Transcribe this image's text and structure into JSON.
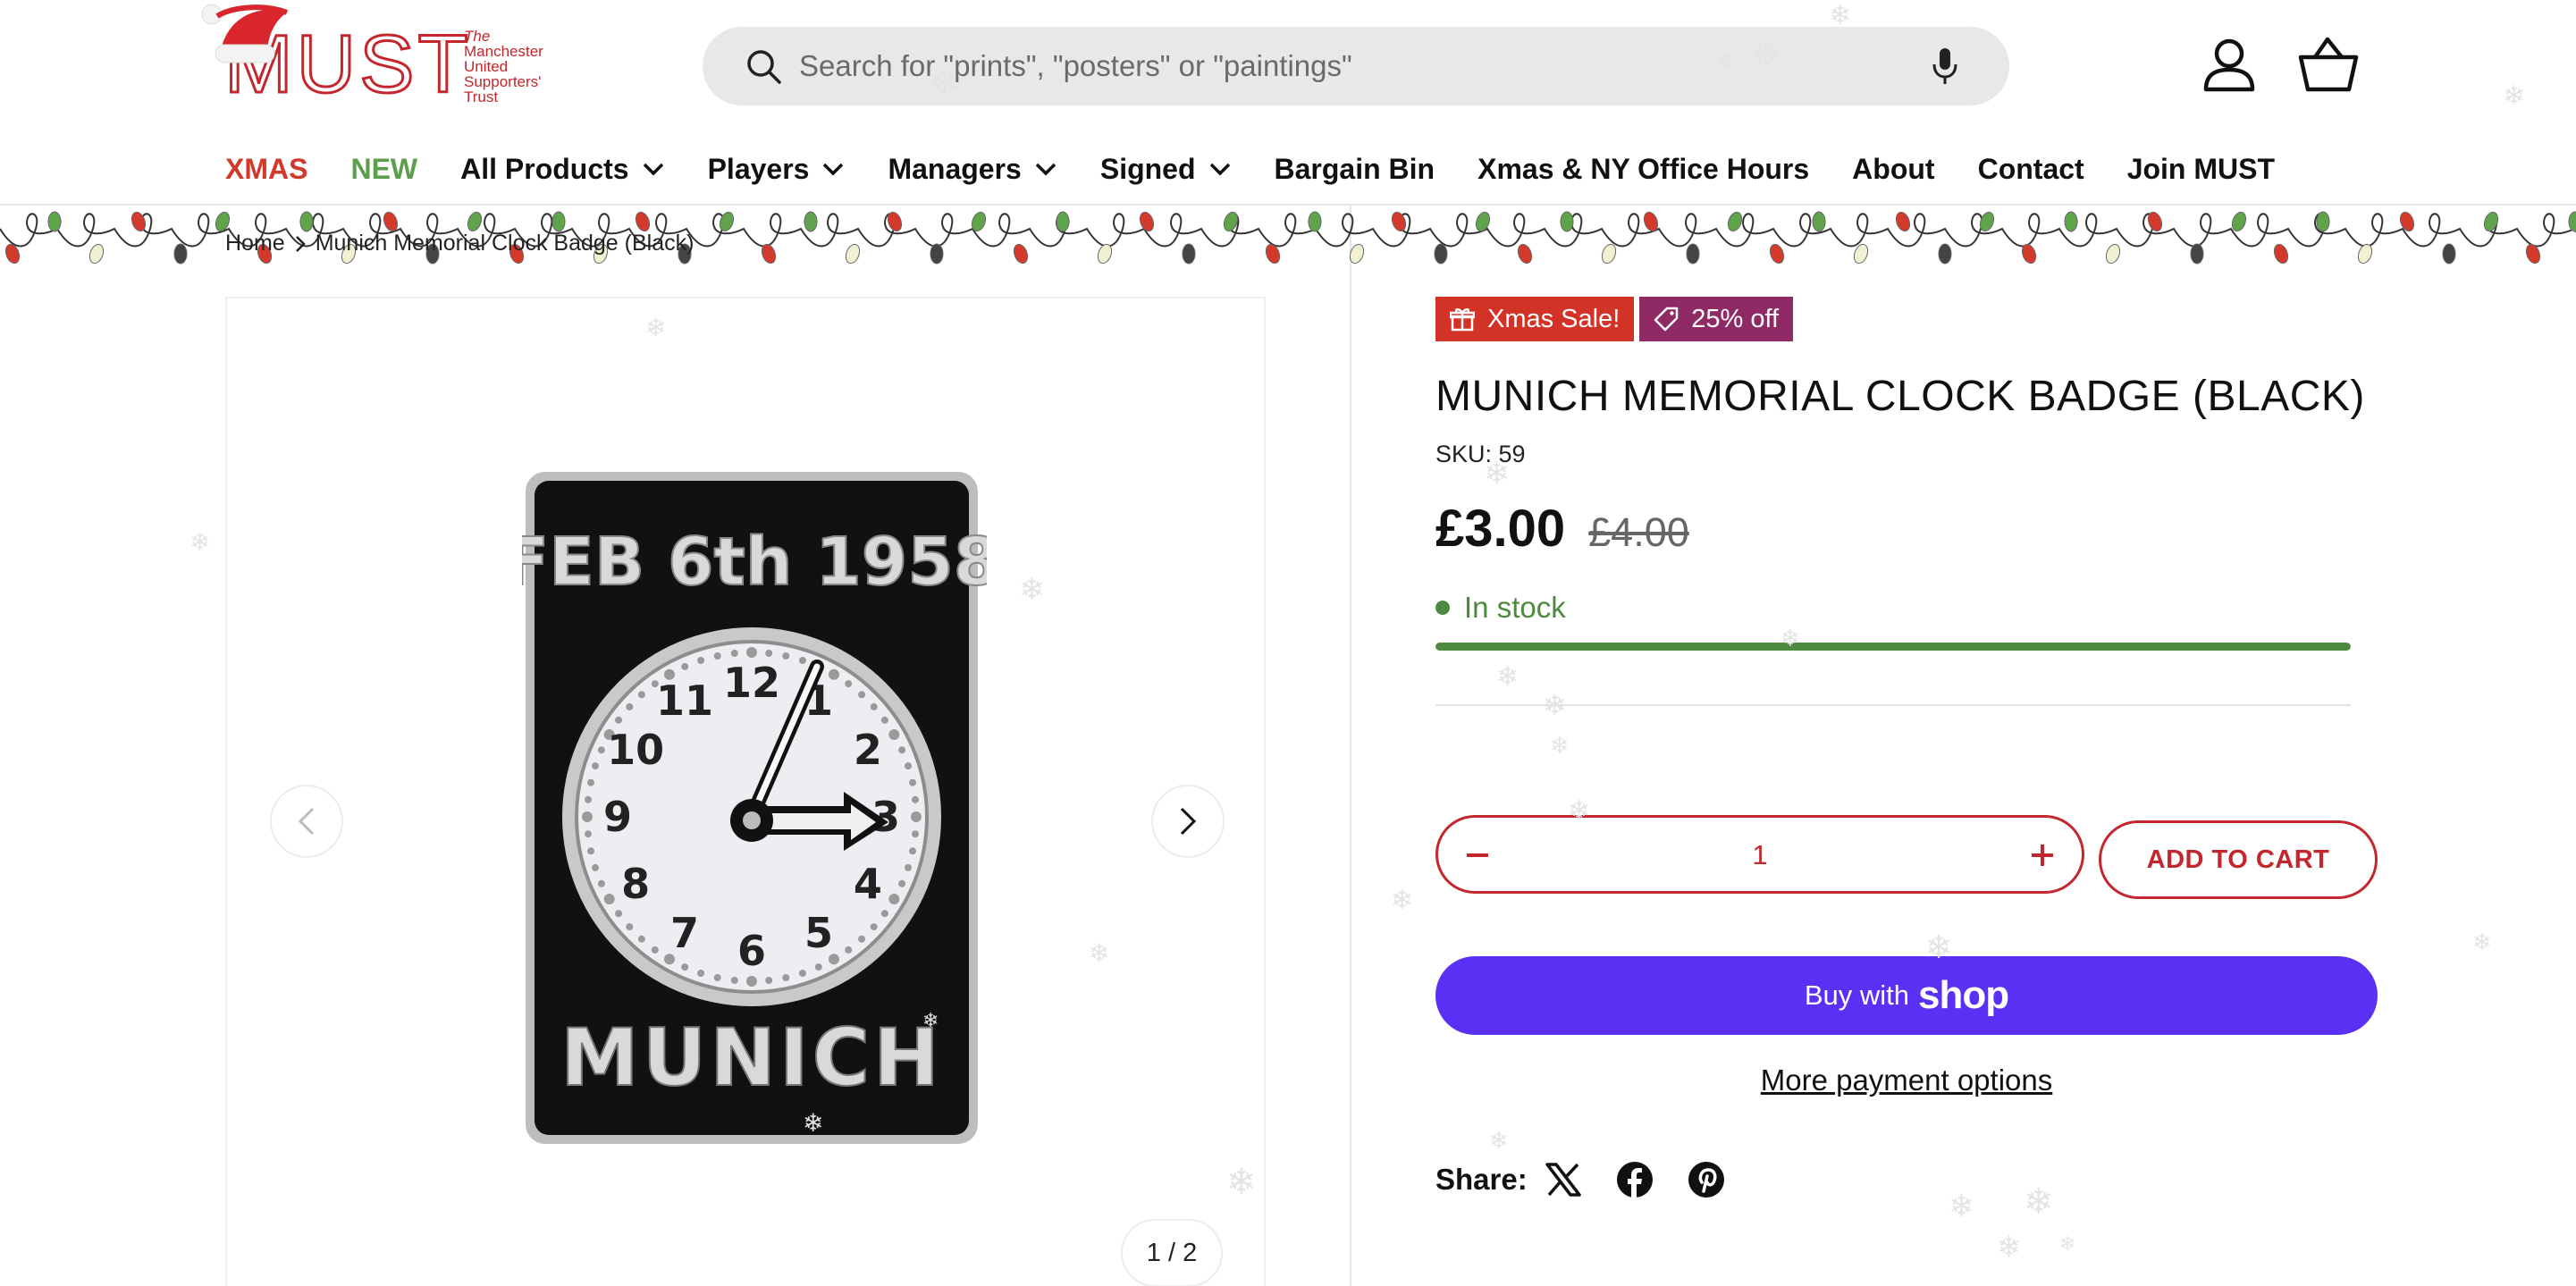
{
  "logo": {
    "word": "MUST",
    "sub": [
      "The",
      "Manchester",
      "United",
      "Supporters'",
      "Trust"
    ]
  },
  "search": {
    "placeholder": "Search for \"prints\", \"posters\" or \"paintings\""
  },
  "nav": [
    {
      "label": "XMAS",
      "dropdown": false,
      "style": "xmas"
    },
    {
      "label": "NEW",
      "dropdown": false,
      "style": "new"
    },
    {
      "label": "All Products",
      "dropdown": true
    },
    {
      "label": "Players",
      "dropdown": true
    },
    {
      "label": "Managers",
      "dropdown": true
    },
    {
      "label": "Signed",
      "dropdown": true
    },
    {
      "label": "Bargain Bin",
      "dropdown": false
    },
    {
      "label": "Xmas & NY Office Hours",
      "dropdown": false
    },
    {
      "label": "About",
      "dropdown": false
    },
    {
      "label": "Contact",
      "dropdown": false
    },
    {
      "label": "Join MUST",
      "dropdown": false
    }
  ],
  "breadcrumb": {
    "home": "Home",
    "current": "Munich Memorial Clock Badge (Black)"
  },
  "gallery": {
    "counter": "1 / 2",
    "badge_top_text": "FEB 6th 1958",
    "badge_bottom_text": "MUNICH"
  },
  "product": {
    "tag_sale": "Xmas Sale!",
    "tag_off": "25% off",
    "title": "MUNICH MEMORIAL CLOCK BADGE (BLACK)",
    "sku": "SKU: 59",
    "price": "£3.00",
    "old_price": "£4.00",
    "stock": "In stock",
    "stock_level": 1.0,
    "quantity": "1",
    "add_to_cart": "ADD TO CART",
    "buy_with": "Buy with",
    "buy_brand": "shop",
    "more_payment": "More payment options",
    "share_label": "Share:"
  },
  "colors": {
    "brand_red": "#c3272d",
    "shop_pay": "#5a31f4",
    "stock_green": "#4d8a3f",
    "sale_tag": "#d33327",
    "off_tag": "#8f2a65"
  },
  "icons": [
    "search-icon",
    "microphone-icon",
    "account-icon",
    "cart-icon",
    "chevron-down-icon",
    "gift-icon",
    "price-tag-icon",
    "chevron-left-icon",
    "chevron-right-icon",
    "minus-icon",
    "plus-icon",
    "x-twitter-icon",
    "facebook-icon",
    "pinterest-icon"
  ]
}
